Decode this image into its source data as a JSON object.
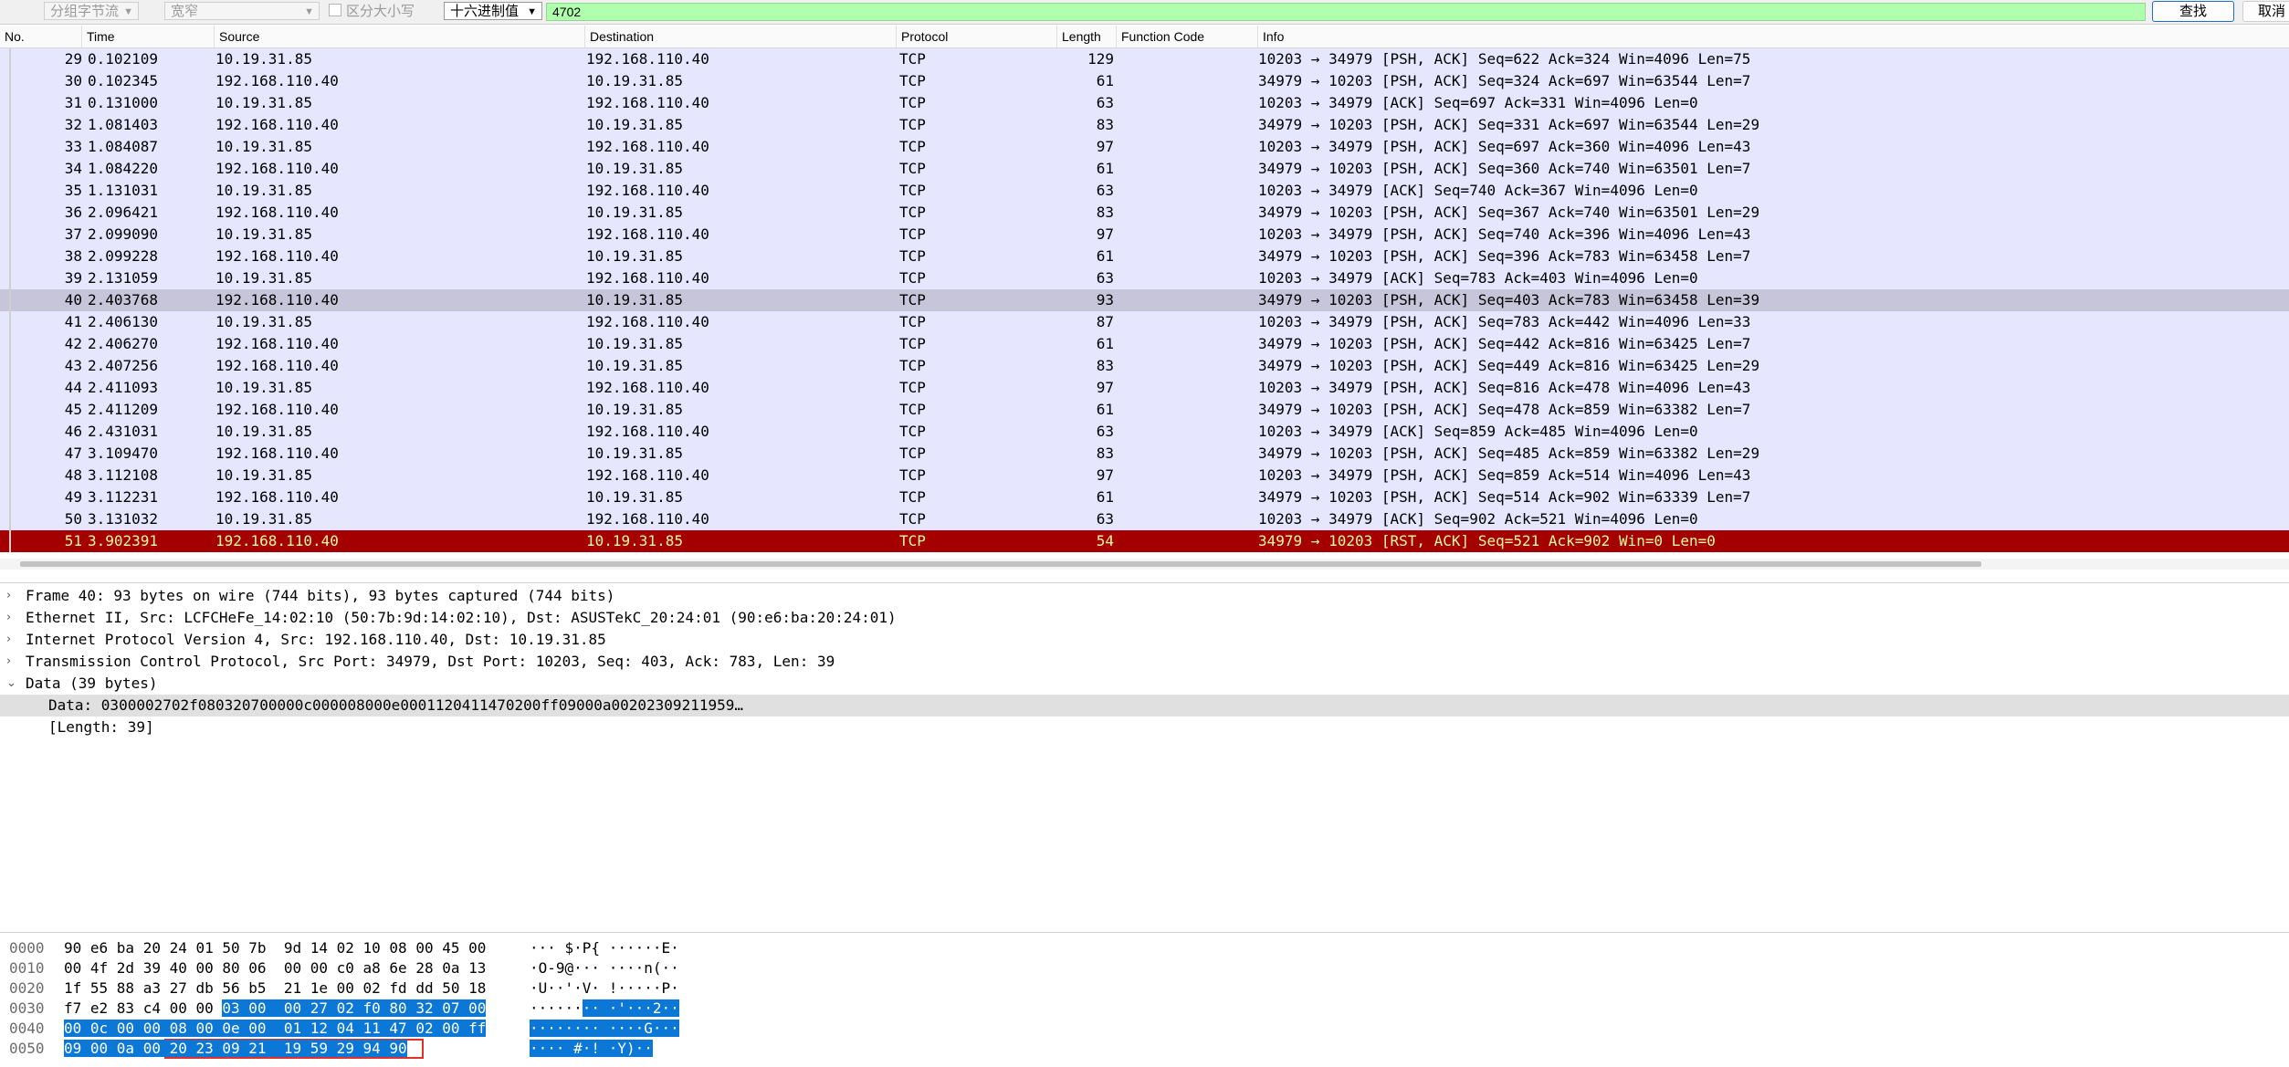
{
  "search_bar": {
    "search_in": "分组字节流",
    "charset": "宽窄",
    "case_sensitive": "区分大小写",
    "display_format": "十六进制值",
    "query": "4702",
    "find_button": "查找",
    "cancel_button": "取消"
  },
  "packet_list": {
    "columns": [
      "No.",
      "Time",
      "Source",
      "Destination",
      "Protocol",
      "Length",
      "Function Code",
      "Info"
    ],
    "rows": [
      {
        "no": "29",
        "time": "0.102109",
        "src": "10.19.31.85",
        "dst": "192.168.110.40",
        "proto": "TCP",
        "len": "129",
        "info": "10203 → 34979 [PSH, ACK] Seq=622 Ack=324 Win=4096 Len=75"
      },
      {
        "no": "30",
        "time": "0.102345",
        "src": "192.168.110.40",
        "dst": "10.19.31.85",
        "proto": "TCP",
        "len": "61",
        "info": "34979 → 10203 [PSH, ACK] Seq=324 Ack=697 Win=63544 Len=7"
      },
      {
        "no": "31",
        "time": "0.131000",
        "src": "10.19.31.85",
        "dst": "192.168.110.40",
        "proto": "TCP",
        "len": "63",
        "info": "10203 → 34979 [ACK] Seq=697 Ack=331 Win=4096 Len=0"
      },
      {
        "no": "32",
        "time": "1.081403",
        "src": "192.168.110.40",
        "dst": "10.19.31.85",
        "proto": "TCP",
        "len": "83",
        "info": "34979 → 10203 [PSH, ACK] Seq=331 Ack=697 Win=63544 Len=29"
      },
      {
        "no": "33",
        "time": "1.084087",
        "src": "10.19.31.85",
        "dst": "192.168.110.40",
        "proto": "TCP",
        "len": "97",
        "info": "10203 → 34979 [PSH, ACK] Seq=697 Ack=360 Win=4096 Len=43"
      },
      {
        "no": "34",
        "time": "1.084220",
        "src": "192.168.110.40",
        "dst": "10.19.31.85",
        "proto": "TCP",
        "len": "61",
        "info": "34979 → 10203 [PSH, ACK] Seq=360 Ack=740 Win=63501 Len=7"
      },
      {
        "no": "35",
        "time": "1.131031",
        "src": "10.19.31.85",
        "dst": "192.168.110.40",
        "proto": "TCP",
        "len": "63",
        "info": "10203 → 34979 [ACK] Seq=740 Ack=367 Win=4096 Len=0"
      },
      {
        "no": "36",
        "time": "2.096421",
        "src": "192.168.110.40",
        "dst": "10.19.31.85",
        "proto": "TCP",
        "len": "83",
        "info": "34979 → 10203 [PSH, ACK] Seq=367 Ack=740 Win=63501 Len=29"
      },
      {
        "no": "37",
        "time": "2.099090",
        "src": "10.19.31.85",
        "dst": "192.168.110.40",
        "proto": "TCP",
        "len": "97",
        "info": "10203 → 34979 [PSH, ACK] Seq=740 Ack=396 Win=4096 Len=43"
      },
      {
        "no": "38",
        "time": "2.099228",
        "src": "192.168.110.40",
        "dst": "10.19.31.85",
        "proto": "TCP",
        "len": "61",
        "info": "34979 → 10203 [PSH, ACK] Seq=396 Ack=783 Win=63458 Len=7"
      },
      {
        "no": "39",
        "time": "2.131059",
        "src": "10.19.31.85",
        "dst": "192.168.110.40",
        "proto": "TCP",
        "len": "63",
        "info": "10203 → 34979 [ACK] Seq=783 Ack=403 Win=4096 Len=0"
      },
      {
        "no": "40",
        "time": "2.403768",
        "src": "192.168.110.40",
        "dst": "10.19.31.85",
        "proto": "TCP",
        "len": "93",
        "info": "34979 → 10203 [PSH, ACK] Seq=403 Ack=783 Win=63458 Len=39"
      },
      {
        "no": "41",
        "time": "2.406130",
        "src": "10.19.31.85",
        "dst": "192.168.110.40",
        "proto": "TCP",
        "len": "87",
        "info": "10203 → 34979 [PSH, ACK] Seq=783 Ack=442 Win=4096 Len=33"
      },
      {
        "no": "42",
        "time": "2.406270",
        "src": "192.168.110.40",
        "dst": "10.19.31.85",
        "proto": "TCP",
        "len": "61",
        "info": "34979 → 10203 [PSH, ACK] Seq=442 Ack=816 Win=63425 Len=7"
      },
      {
        "no": "43",
        "time": "2.407256",
        "src": "192.168.110.40",
        "dst": "10.19.31.85",
        "proto": "TCP",
        "len": "83",
        "info": "34979 → 10203 [PSH, ACK] Seq=449 Ack=816 Win=63425 Len=29"
      },
      {
        "no": "44",
        "time": "2.411093",
        "src": "10.19.31.85",
        "dst": "192.168.110.40",
        "proto": "TCP",
        "len": "97",
        "info": "10203 → 34979 [PSH, ACK] Seq=816 Ack=478 Win=4096 Len=43"
      },
      {
        "no": "45",
        "time": "2.411209",
        "src": "192.168.110.40",
        "dst": "10.19.31.85",
        "proto": "TCP",
        "len": "61",
        "info": "34979 → 10203 [PSH, ACK] Seq=478 Ack=859 Win=63382 Len=7"
      },
      {
        "no": "46",
        "time": "2.431031",
        "src": "10.19.31.85",
        "dst": "192.168.110.40",
        "proto": "TCP",
        "len": "63",
        "info": "10203 → 34979 [ACK] Seq=859 Ack=485 Win=4096 Len=0"
      },
      {
        "no": "47",
        "time": "3.109470",
        "src": "192.168.110.40",
        "dst": "10.19.31.85",
        "proto": "TCP",
        "len": "83",
        "info": "34979 → 10203 [PSH, ACK] Seq=485 Ack=859 Win=63382 Len=29"
      },
      {
        "no": "48",
        "time": "3.112108",
        "src": "10.19.31.85",
        "dst": "192.168.110.40",
        "proto": "TCP",
        "len": "97",
        "info": "10203 → 34979 [PSH, ACK] Seq=859 Ack=514 Win=4096 Len=43"
      },
      {
        "no": "49",
        "time": "3.112231",
        "src": "192.168.110.40",
        "dst": "10.19.31.85",
        "proto": "TCP",
        "len": "61",
        "info": "34979 → 10203 [PSH, ACK] Seq=514 Ack=902 Win=63339 Len=7"
      },
      {
        "no": "50",
        "time": "3.131032",
        "src": "10.19.31.85",
        "dst": "192.168.110.40",
        "proto": "TCP",
        "len": "63",
        "info": "10203 → 34979 [ACK] Seq=902 Ack=521 Win=4096 Len=0"
      },
      {
        "no": "51",
        "time": "3.902391",
        "src": "192.168.110.40",
        "dst": "10.19.31.85",
        "proto": "TCP",
        "len": "54",
        "info": "34979 → 10203 [RST, ACK] Seq=521 Ack=902 Win=0 Len=0"
      }
    ],
    "selected_no": "40",
    "rst_no": "51"
  },
  "details": [
    {
      "text": "Frame 40: 93 bytes on wire (744 bits), 93 bytes captured (744 bits)",
      "arrow": ">",
      "level": 0
    },
    {
      "text": "Ethernet II, Src: LCFCHeFe_14:02:10 (50:7b:9d:14:02:10), Dst: ASUSTekC_20:24:01 (90:e6:ba:20:24:01)",
      "arrow": ">",
      "level": 0
    },
    {
      "text": "Internet Protocol Version 4, Src: 192.168.110.40, Dst: 10.19.31.85",
      "arrow": ">",
      "level": 0
    },
    {
      "text": "Transmission Control Protocol, Src Port: 34979, Dst Port: 10203, Seq: 403, Ack: 783, Len: 39",
      "arrow": ">",
      "level": 0
    },
    {
      "text": "Data (39 bytes)",
      "arrow": "v",
      "level": 0
    },
    {
      "text": "Data: 0300002702f080320700000c000008000e0001120411470200ff09000a00202309211959…",
      "arrow": "",
      "level": 1
    },
    {
      "text": "[Length: 39]",
      "arrow": "",
      "level": 1
    }
  ],
  "bytes": [
    {
      "offset": "0000",
      "hex_plain": "90 e6 ba 20 24 01 50 7b  9d 14 02 10 08 00 45 00",
      "hex_sel": "",
      "hex_tail": "",
      "ascii_plain": "··· $·P{ ······E·",
      "ascii_sel": ""
    },
    {
      "offset": "0010",
      "hex_plain": "00 4f 2d 39 40 00 80 06  00 00 c0 a8 6e 28 0a 13",
      "hex_sel": "",
      "hex_tail": "",
      "ascii_plain": "·O-9@··· ····n(··",
      "ascii_sel": ""
    },
    {
      "offset": "0020",
      "hex_plain": "1f 55 88 a3 27 db 56 b5  21 1e 00 02 fd dd 50 18",
      "hex_sel": "",
      "hex_tail": "",
      "ascii_plain": "·U··'·V· !·····P·",
      "ascii_sel": ""
    },
    {
      "offset": "0030",
      "hex_plain": "f7 e2 83 c4 00 00 ",
      "hex_sel": "03 00  00 27 02 f0 80 32 07 00",
      "hex_tail": "",
      "ascii_plain": "······",
      "ascii_sel": "·· ·'···2··"
    },
    {
      "offset": "0040",
      "hex_plain": "",
      "hex_sel": "00 0c 00 00 08 00 0e 00  01 12 04 11 47 02 00 ff",
      "hex_tail": "",
      "ascii_plain": "",
      "ascii_sel": "········ ····G···"
    },
    {
      "offset": "0050",
      "hex_plain": "",
      "hex_sel": "09 00 0a 00 20 23 09 21  19 59 29 94 90",
      "hex_tail": "",
      "ascii_plain": "",
      "ascii_sel": "···· #·! ·Y)··"
    }
  ],
  "colors": {
    "row_bg": "#e7e6ff",
    "selected_row": "#c6c5da",
    "rst_row": "#a40000",
    "rst_text": "#fffc9c",
    "search_input_bg": "#afffaf",
    "byte_highlight": "#0b77d6",
    "match_box": "#e0302c"
  }
}
